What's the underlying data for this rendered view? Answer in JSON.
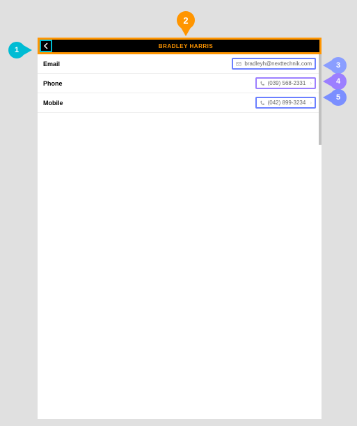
{
  "header": {
    "title": "BRADLEY HARRIS"
  },
  "rows": {
    "email": {
      "label": "Email",
      "value": "bradleyh@nexttechnik.com"
    },
    "phone": {
      "label": "Phone",
      "value": "(039) 568-2331"
    },
    "mobile": {
      "label": "Mobile",
      "value": "(042) 899-3234"
    }
  },
  "pins": {
    "p1": "1",
    "p2": "2",
    "p3": "3",
    "p4": "4",
    "p5": "5"
  }
}
